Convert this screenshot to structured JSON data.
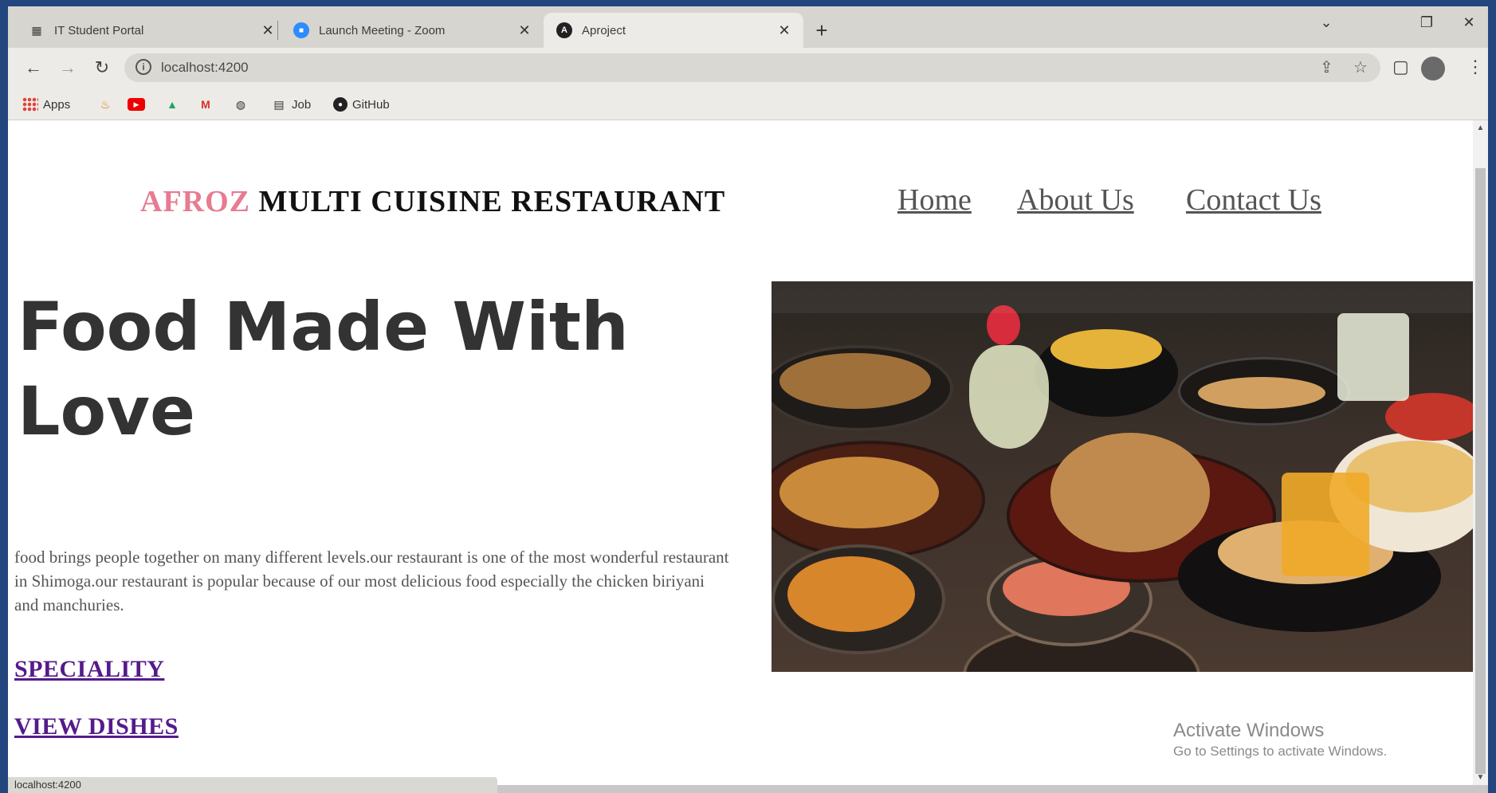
{
  "browser": {
    "tabs": [
      {
        "title": "IT Student Portal",
        "icon": "portal-icon",
        "active": false
      },
      {
        "title": "Launch Meeting - Zoom",
        "icon": "zoom-icon",
        "active": false
      },
      {
        "title": "Aproject",
        "icon": "angular-icon",
        "active": true
      }
    ],
    "url": "localhost:4200",
    "bookmarks": [
      {
        "label": "Apps",
        "icon": "apps-grid-icon"
      },
      {
        "label": "",
        "icon": "java-icon"
      },
      {
        "label": "",
        "icon": "youtube-icon"
      },
      {
        "label": "",
        "icon": "google-drive-icon"
      },
      {
        "label": "",
        "icon": "gmail-icon"
      },
      {
        "label": "",
        "icon": "globe-icon"
      },
      {
        "label": "Job",
        "icon": "job-icon"
      },
      {
        "label": "GitHub",
        "icon": "github-icon"
      }
    ],
    "status_url": "localhost:4200"
  },
  "site": {
    "brand_accent": "AFROZ",
    "brand_rest": "MULTI CUISINE RESTAURANT",
    "nav": [
      "Home",
      "About Us",
      "Contact Us"
    ],
    "hero_title": "Food Made With Love",
    "hero_text": "food brings people together on many different levels.our restaurant is one of the most wonderful restaurant in Shimoga.our restaurant is popular because of our most delicious food especially the chicken biriyani and manchuries.",
    "cta_speciality": "SPECIALITY",
    "cta_dishes": "VIEW DISHES",
    "colors": {
      "accent": "#e67b91",
      "link_visited": "#551a8b",
      "title": "#333333"
    }
  },
  "watermark": {
    "line1": "Activate Windows",
    "line2": "Go to Settings to activate Windows."
  }
}
